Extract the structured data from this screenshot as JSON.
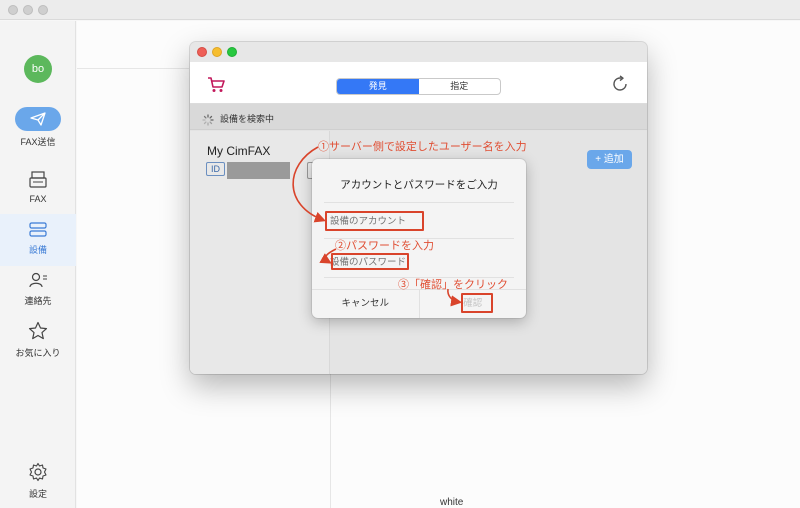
{
  "sidebar": {
    "avatar_text": "bo",
    "items": [
      {
        "label": "FAX送信",
        "icon": "paper-plane-icon"
      },
      {
        "label": "FAX",
        "icon": "fax-machine-icon"
      },
      {
        "label": "設備",
        "icon": "device-icon"
      },
      {
        "label": "連絡先",
        "icon": "contacts-icon"
      },
      {
        "label": "お気に入り",
        "icon": "star-icon"
      }
    ],
    "settings_label": "設定"
  },
  "dialog": {
    "segments": [
      "発見",
      "指定"
    ],
    "active_segment": "発見",
    "searching_text": "設備を検索中",
    "device_name": "My CimFAX",
    "id_tag": "ID",
    "add_button": "+ 追加"
  },
  "login_sheet": {
    "title": "アカウントとパスワードをご入力",
    "account_placeholder": "設備のアカウント",
    "password_placeholder": "設備のパスワード",
    "cancel_label": "キャンセル",
    "confirm_label": "確認"
  },
  "annotations": {
    "step1": "①サーバー側で設定したユーザー名を入力",
    "step2": "②パスワードを入力",
    "step3": "③「確認」をクリック"
  },
  "background": {
    "stray_text": "white"
  },
  "colors": {
    "accent_blue": "#3478f6",
    "button_blue": "#6aa7ea",
    "annotation_red": "#e04e33",
    "avatar_green": "#5cb85c"
  }
}
